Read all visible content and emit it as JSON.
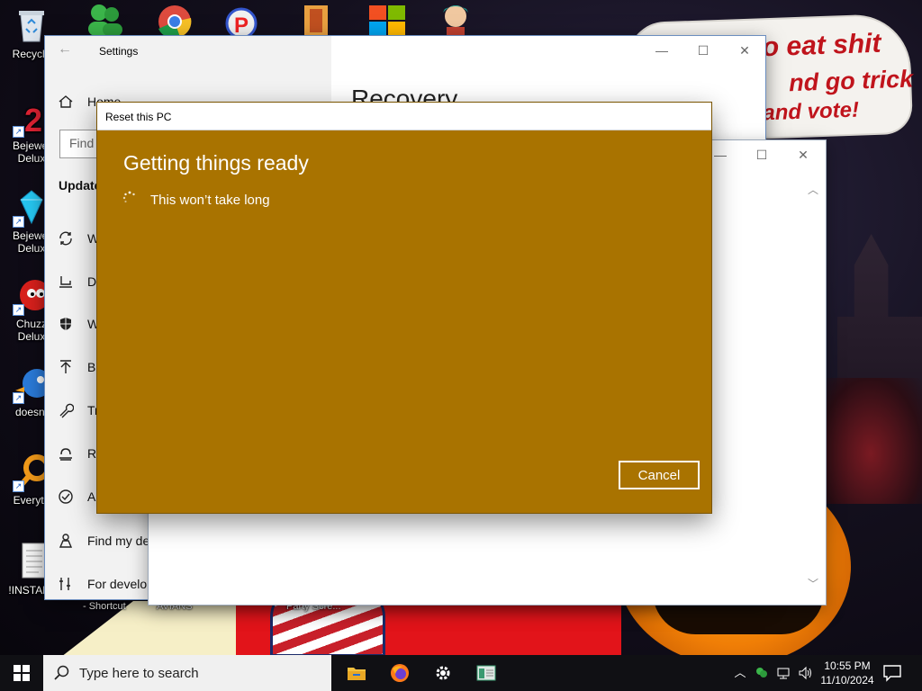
{
  "desktop": {
    "banner_lines": [
      "o eat shit",
      "nd go trick",
      "and vote!"
    ],
    "icons": [
      {
        "label": "Recycle",
        "name": "recycle-bin-icon"
      },
      {
        "label": "Bejewel\nDelux",
        "name": "bejeweled-2-icon"
      },
      {
        "label": "Bejewel\nDelux",
        "name": "bejeweled-icon"
      },
      {
        "label": "Chuzz\nDelux",
        "name": "chuzzle-icon"
      },
      {
        "label": "doesnt",
        "name": "bird-app-icon"
      },
      {
        "label": "Everyth",
        "name": "everything-search-icon"
      },
      {
        "label": "!INSTALL",
        "name": "install-document-icon"
      }
    ],
    "bottom_captions": [
      "- Shortcut",
      "AVIANS",
      "Party Scre..."
    ]
  },
  "settings": {
    "window_title": "Settings",
    "page_title": "Recovery",
    "find_placeholder": "Find",
    "nav_heading": "Update",
    "nav_items": [
      {
        "label": "Home"
      },
      {
        "label": "W"
      },
      {
        "label": "De"
      },
      {
        "label": "W"
      },
      {
        "label": "Ba"
      },
      {
        "label": "Tr"
      },
      {
        "label": "Re"
      },
      {
        "label": "Ac"
      },
      {
        "label": "Find my de"
      },
      {
        "label": "For develop"
      }
    ]
  },
  "reset_dialog": {
    "title": "Reset this PC",
    "heading": "Getting things ready",
    "subtext": "This won’t take long",
    "cancel_label": "Cancel",
    "background_color": "#a97300"
  },
  "taskbar": {
    "search_placeholder": "Type here to search",
    "time": "10:55 PM",
    "date": "11/10/2024"
  }
}
